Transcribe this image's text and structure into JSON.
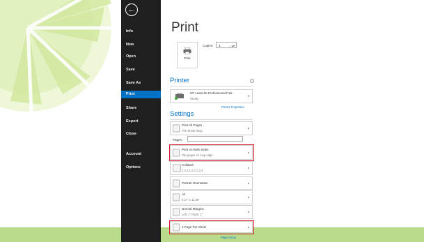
{
  "sidebar": {
    "back_glyph": "←",
    "items": [
      {
        "label": "Info"
      },
      {
        "label": "New"
      },
      {
        "label": "Open"
      },
      {
        "label": "Save"
      },
      {
        "label": "Save As"
      },
      {
        "label": "Print",
        "active": true
      },
      {
        "label": "Share"
      },
      {
        "label": "Export"
      },
      {
        "label": "Close"
      },
      {
        "label": "Account"
      },
      {
        "label": "Options"
      }
    ]
  },
  "main": {
    "title": "Print",
    "print_button_label": "Print",
    "copies_label": "Copies:",
    "copies_value": "1",
    "printer": {
      "heading": "Printer",
      "name": "HP LaserJet Professional P16...",
      "status": "Ready",
      "properties_link": "Printer Properties"
    },
    "settings": {
      "heading": "Settings",
      "pages_label": "Pages:",
      "options": [
        {
          "title": "Print All Pages",
          "subtitle": "The whole thing"
        },
        {
          "title": "Print on Both Sides",
          "subtitle": "Flip pages on long edge"
        },
        {
          "title": "Collated",
          "subtitle": "1,2,3    1,2,3    1,2,3"
        },
        {
          "title": "Portrait Orientation",
          "subtitle": ""
        },
        {
          "title": "A4",
          "subtitle": "8.27\" x 11.69\""
        },
        {
          "title": "Normal Margins",
          "subtitle": "Left: 1\"    Right: 1\""
        },
        {
          "title": "1 Page Per Sheet",
          "subtitle": ""
        }
      ],
      "page_setup_link": "Page Setup"
    }
  },
  "colors": {
    "accent": "#0072c6",
    "sidebar_bg": "#1f1f1f",
    "highlight": "#d91a2a",
    "lime_band": "#b9dc8c"
  }
}
